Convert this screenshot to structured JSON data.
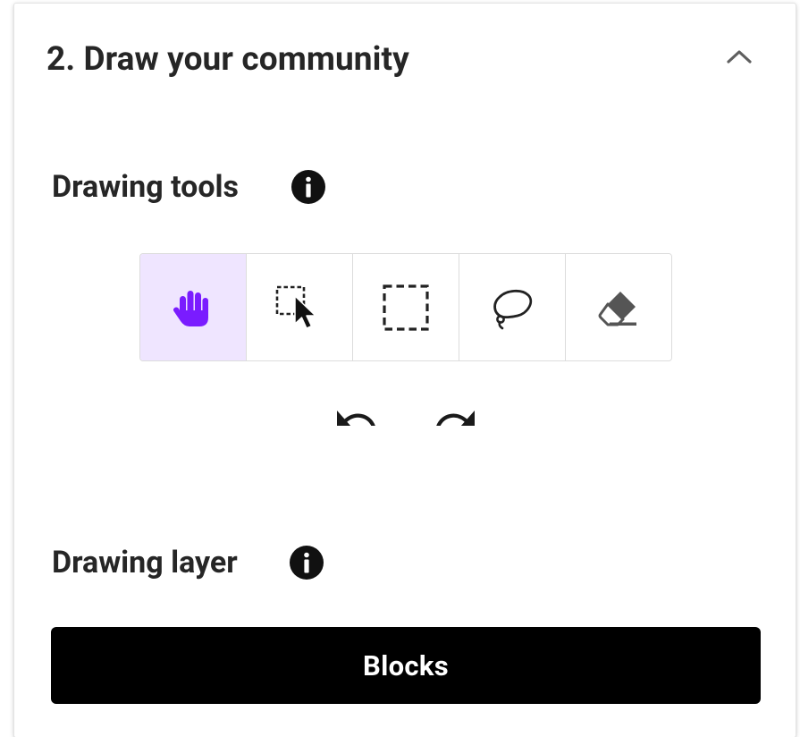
{
  "section": {
    "title": "2. Draw your community",
    "collapse_icon": "chevron-up-icon"
  },
  "drawing_tools": {
    "heading": "Drawing tools",
    "info_icon": "info-icon",
    "tools": [
      {
        "name": "pan",
        "icon": "hand-icon",
        "active": true,
        "color": "#7a1cff"
      },
      {
        "name": "select",
        "icon": "box-select-cursor-icon",
        "active": false
      },
      {
        "name": "rectangle-select",
        "icon": "dashed-rectangle-icon",
        "active": false
      },
      {
        "name": "lasso-select",
        "icon": "lasso-icon",
        "active": false
      },
      {
        "name": "erase",
        "icon": "eraser-icon",
        "active": false
      }
    ],
    "history": {
      "undo_icon": "undo-icon",
      "redo_icon": "redo-icon"
    }
  },
  "drawing_layer": {
    "heading": "Drawing layer",
    "info_icon": "info-icon",
    "selected_layer": "Blocks"
  },
  "colors": {
    "accent": "#7a1cff",
    "active_tool_bg": "#efe5ff",
    "primary_button_bg": "#000000",
    "text": "#262626"
  }
}
